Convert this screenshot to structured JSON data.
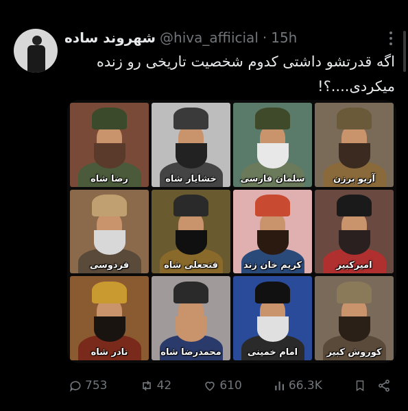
{
  "tweet": {
    "display_name": "شهروند ساده",
    "handle": "@hiva_affiicial",
    "separator": "·",
    "time": "15h",
    "text": "اگه قدرتشو داشتی کدوم شخصیت تاریخی رو زنده\nمیکردی....؟!"
  },
  "media": {
    "portraits": [
      {
        "name": "آریو برزن",
        "colors": {
          "bg": "#7a6a58",
          "hat": "#6b5a3a",
          "beard": "#3a2a20",
          "clothes": "#8a6a3a"
        }
      },
      {
        "name": "سلمان فارسی",
        "colors": {
          "bg": "#5a7a6a",
          "hat": "#3f4a2a",
          "beard": "#e8e8e8",
          "clothes": "#6a7a5a"
        }
      },
      {
        "name": "خشایار شاه",
        "colors": {
          "bg": "#bdbdbd",
          "hat": "#3a3a3a",
          "beard": "#222222",
          "clothes": "#444444"
        }
      },
      {
        "name": "رضا شاه",
        "colors": {
          "bg": "#7a4a38",
          "hat": "#3a4a2a",
          "beard": "#5a3a2a",
          "clothes": "#4a5a3a"
        }
      },
      {
        "name": "امیرکبیر",
        "colors": {
          "bg": "#6a4a40",
          "hat": "#1a1a1a",
          "beard": "#2a2020",
          "clothes": "#b03030"
        }
      },
      {
        "name": "کریم خان زند",
        "colors": {
          "bg": "#e0b0b0",
          "hat": "#c84a30",
          "beard": "#2a1a10",
          "clothes": "#2a4a7a"
        }
      },
      {
        "name": "فتحعلی شاه",
        "colors": {
          "bg": "#6a5a30",
          "hat": "#2a2a2a",
          "beard": "#101010",
          "clothes": "#8a6a2a"
        }
      },
      {
        "name": "فردوسی",
        "colors": {
          "bg": "#8a6a4a",
          "hat": "#c0a070",
          "beard": "#d8d8d8",
          "clothes": "#5a4a3a"
        }
      },
      {
        "name": "کوروش کبیر",
        "colors": {
          "bg": "#7a6a5a",
          "hat": "#8a7a5a",
          "beard": "#2a2018",
          "clothes": "#5a4a3a"
        }
      },
      {
        "name": "امام خمینی",
        "colors": {
          "bg": "#2a4a9a",
          "hat": "#111111",
          "beard": "#e0e0e0",
          "clothes": "#2a2a2a"
        }
      },
      {
        "name": "محمدرضا شاه",
        "colors": {
          "bg": "#a09a9a",
          "hat": "#2a2a2a",
          "beard": "#c9936b",
          "clothes": "#2a3a6a"
        }
      },
      {
        "name": "نادر شاه",
        "colors": {
          "bg": "#8a5a30",
          "hat": "#c89a30",
          "beard": "#1a1410",
          "clothes": "#7a2a1a"
        }
      }
    ]
  },
  "actions": {
    "replies": "753",
    "retweets": "42",
    "likes": "610",
    "views": "66.3K"
  },
  "icons": [
    "more-icon",
    "reply-icon",
    "retweet-icon",
    "like-icon",
    "views-icon",
    "bookmark-icon",
    "share-icon"
  ],
  "colors": {
    "muted": "#71767b",
    "text": "#e7e9ea",
    "background": "#000000"
  }
}
